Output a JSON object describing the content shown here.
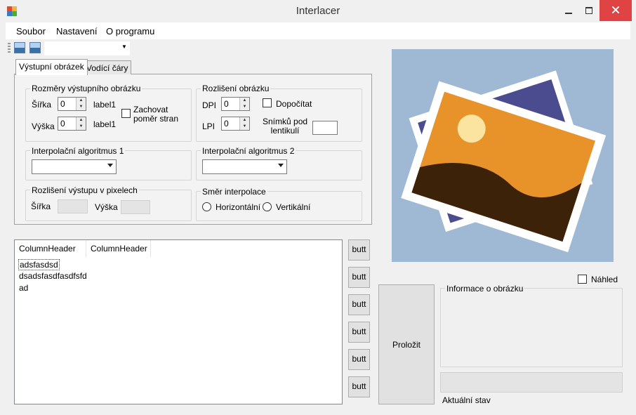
{
  "window": {
    "title": "Interlacer"
  },
  "menu": {
    "file": "Soubor",
    "settings": "Nastavení",
    "about": "O programu"
  },
  "toolbar": {
    "icon1": "image-icon",
    "icon2": "image-icon",
    "combo_value": ""
  },
  "tabs": {
    "output": "Výstupní obrázek",
    "guides": "Vodící čáry"
  },
  "output_size": {
    "title": "Rozměry výstupního obrázku",
    "width_label": "Šířka",
    "width_value": "0",
    "width_unit": "label1",
    "height_label": "Výška",
    "height_value": "0",
    "height_unit": "label1",
    "keep_ratio_line1": "Zachovat",
    "keep_ratio_line2": "poměr stran"
  },
  "resolution": {
    "title": "Rozlišení obrázku",
    "dpi_label": "DPI",
    "dpi_value": "0",
    "lpi_label": "LPI",
    "lpi_value": "0",
    "compute_label": "Dopočítat",
    "frames_line1": "Snímků pod",
    "frames_line2": "lentikulí",
    "frames_value": ""
  },
  "interp1": {
    "title": "Interpolační algoritmus 1",
    "value": ""
  },
  "interp2": {
    "title": "Interpolační algoritmus 2",
    "value": ""
  },
  "pixel_res": {
    "title": "Rozlišení výstupu v pixelech",
    "width_label": "Šířka",
    "height_label": "Výška"
  },
  "direction": {
    "title": "Směr interpolace",
    "horizontal": "Horizontální",
    "vertical": "Vertikální"
  },
  "list": {
    "columns": [
      "ColumnHeader",
      "ColumnHeader"
    ],
    "items": [
      "adsfasdsd",
      "dsadsfasdfasdfsfd",
      "ad"
    ]
  },
  "side_buttons": [
    "butt",
    "butt",
    "butt",
    "butt",
    "butt",
    "butt"
  ],
  "preview_label": "Náhled",
  "interlace_button": "Proložit",
  "info": {
    "title": "Informace o obrázku"
  },
  "status": {
    "label": "Aktuální stav"
  },
  "colors": {
    "close": "#e04343",
    "preview_bg": "#9fb8d3"
  }
}
